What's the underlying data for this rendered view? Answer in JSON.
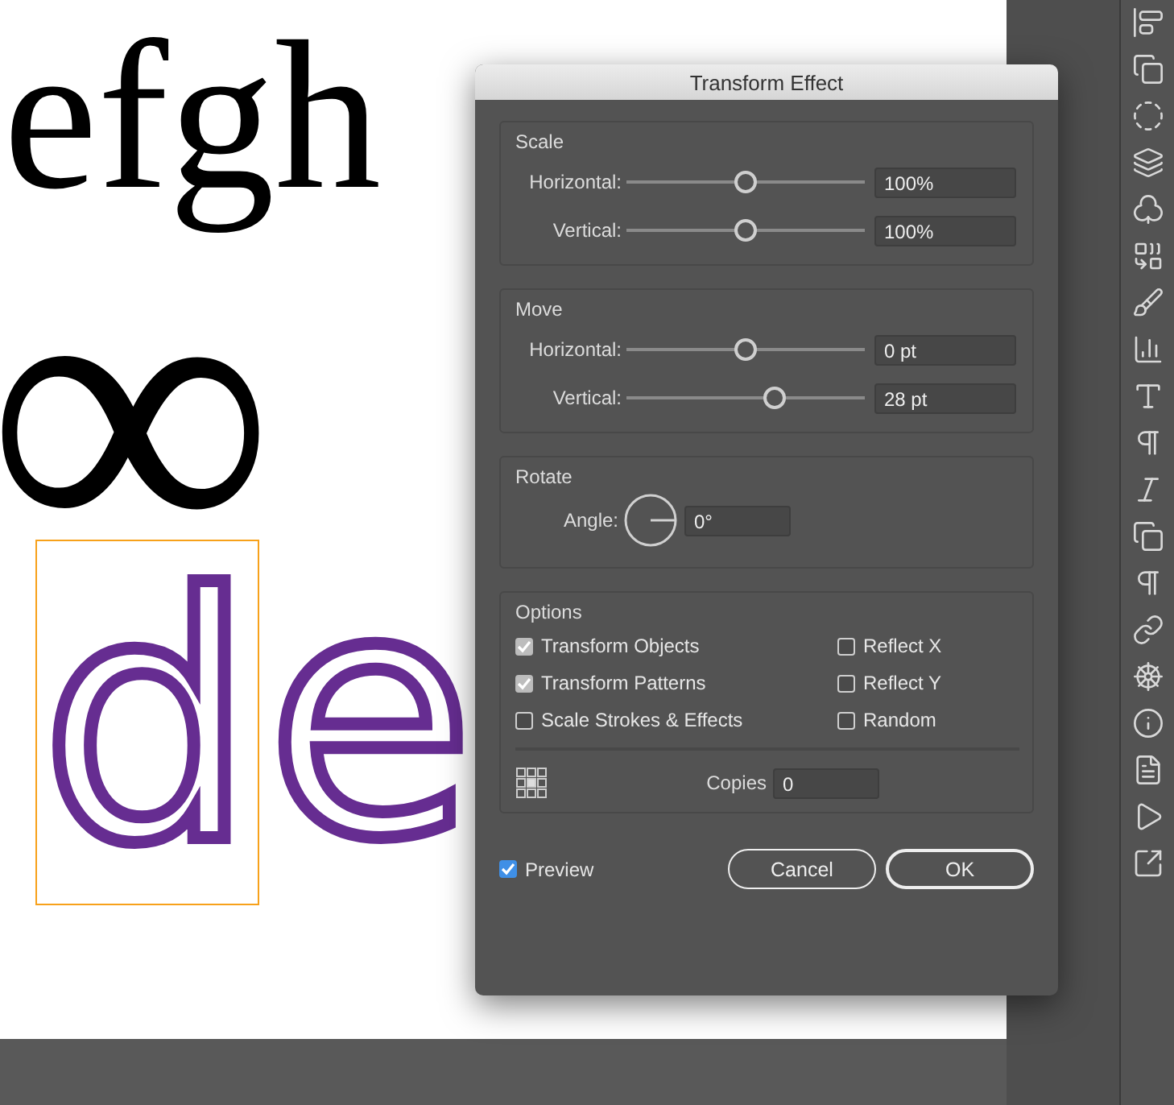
{
  "artwork": {
    "serif_line": "efgh",
    "symbol_line": "∞",
    "outlined_letters": [
      "d",
      "e"
    ]
  },
  "dialog": {
    "title": "Transform Effect",
    "groups": [
      {
        "title": "Scale",
        "rows": [
          {
            "label": "Horizontal:",
            "level": 0.5,
            "value": "100%"
          },
          {
            "label": "Vertical:",
            "level": 0.5,
            "value": "100%"
          }
        ]
      },
      {
        "title": "Move",
        "rows": [
          {
            "label": "Horizontal:",
            "level": 0.5,
            "value": "0 pt"
          },
          {
            "label": "Vertical:",
            "level": 0.62,
            "value": "28 pt"
          }
        ]
      }
    ],
    "rotate": {
      "title": "Rotate",
      "label": "Angle:",
      "value": "0°"
    },
    "options": {
      "title": "Options",
      "left": [
        {
          "label": "Transform Objects",
          "checked": true
        },
        {
          "label": "Transform Patterns",
          "checked": true
        },
        {
          "label": "Scale Strokes & Effects",
          "checked": false
        }
      ],
      "right": [
        {
          "label": "Reflect X",
          "checked": false
        },
        {
          "label": "Reflect Y",
          "checked": false
        },
        {
          "label": "Random",
          "checked": false
        }
      ],
      "copies_label": "Copies",
      "copies_value": "0"
    },
    "preview": {
      "label": "Preview",
      "checked": true
    },
    "buttons": [
      {
        "label": "Cancel",
        "kind": "secondary"
      },
      {
        "label": "OK",
        "kind": "default"
      }
    ]
  }
}
